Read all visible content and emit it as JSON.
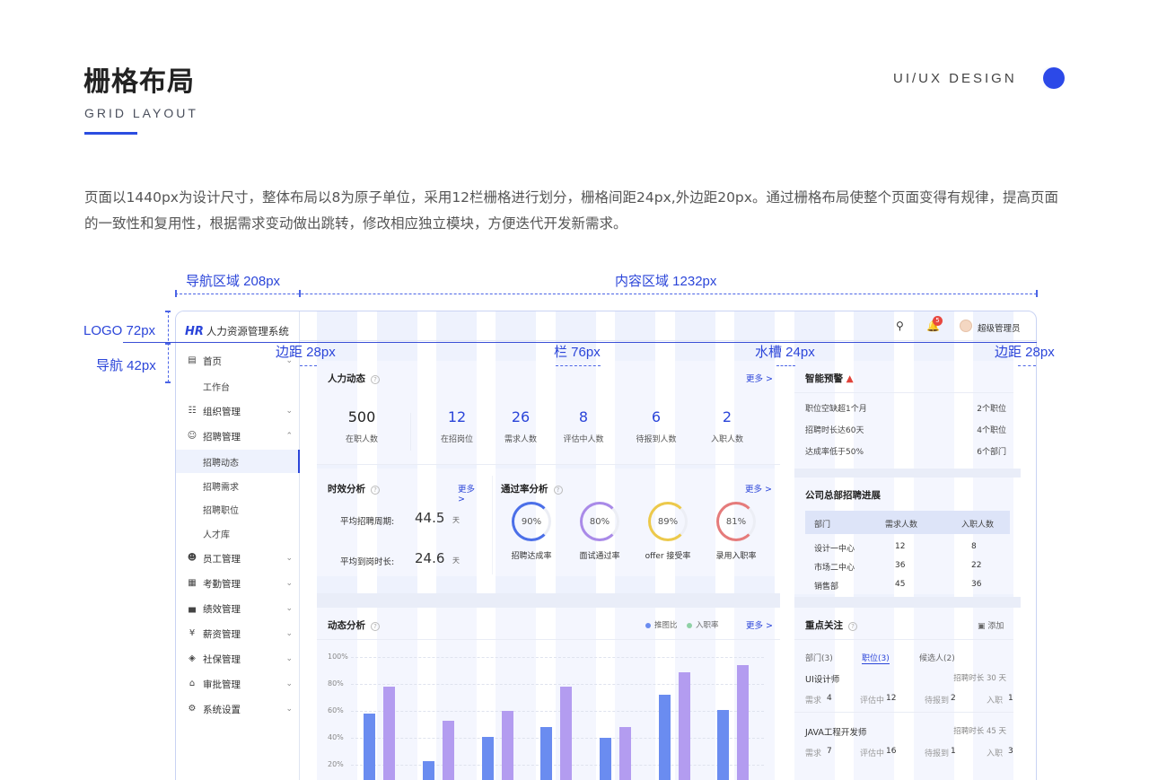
{
  "header": {
    "title": "栅格布局",
    "subtitle": "GRID LAYOUT",
    "brand_tag": "UI/UX DESIGN"
  },
  "description": "页面以1440px为设计尺寸，整体布局以8为原子单位，采用12栏栅格进行划分，栅格间距24px,外边距20px。通过栅格布局使整个页面变得有规律，提高页面的一致性和复用性，根据需求变动做出跳转，修改相应独立模块，方便迭代开发新需求。",
  "annotations": {
    "nav_area": "导航区域 208px",
    "content_area": "内容区域 1232px",
    "logo": "LOGO 72px",
    "nav": "导航 42px",
    "margin_left": "边距 28px",
    "column": "栏 76px",
    "gutter": "水槽 24px",
    "margin_right": "边距 28px"
  },
  "app": {
    "brand_mark": "HR",
    "brand_name": "人力资源管理系统",
    "notification_count": "5",
    "user_name": "超级管理员",
    "nav": [
      {
        "label": "首页",
        "icon": "dashboard-icon",
        "expandable": true
      },
      {
        "label": "工作台",
        "sub": true
      },
      {
        "label": "组织管理",
        "icon": "org-icon",
        "expandable": true
      },
      {
        "label": "招聘管理",
        "icon": "user-icon",
        "expandable": true,
        "open": true
      },
      {
        "label": "招聘动态",
        "sub": true,
        "active": true
      },
      {
        "label": "招聘需求",
        "sub": true
      },
      {
        "label": "招聘职位",
        "sub": true
      },
      {
        "label": "人才库",
        "sub": true
      },
      {
        "label": "员工管理",
        "icon": "staff-icon",
        "expandable": true
      },
      {
        "label": "考勤管理",
        "icon": "calendar-icon",
        "expandable": true
      },
      {
        "label": "绩效管理",
        "icon": "chart-icon",
        "expandable": true
      },
      {
        "label": "薪资管理",
        "icon": "money-icon",
        "expandable": true
      },
      {
        "label": "社保管理",
        "icon": "shield-icon",
        "expandable": true
      },
      {
        "label": "审批管理",
        "icon": "stamp-icon",
        "expandable": true
      },
      {
        "label": "系统设置",
        "icon": "gear-icon",
        "expandable": true
      }
    ],
    "hr_dynamics": {
      "title": "人力动态",
      "more": "更多 >",
      "stats": [
        {
          "value": "500",
          "label": "在职人数"
        },
        {
          "value": "12",
          "label": "在招岗位"
        },
        {
          "value": "26",
          "label": "需求人数"
        },
        {
          "value": "8",
          "label": "评估中人数"
        },
        {
          "value": "6",
          "label": "待报到人数"
        },
        {
          "value": "2",
          "label": "入职人数"
        }
      ]
    },
    "efficiency": {
      "title": "时效分析",
      "more": "更多 >",
      "rows": [
        {
          "label": "平均招聘周期:",
          "value": "44.5",
          "unit": "天"
        },
        {
          "label": "平均到岗时长:",
          "value": "24.6",
          "unit": "天"
        }
      ]
    },
    "pass_rate": {
      "title": "通过率分析",
      "more": "更多 >",
      "items": [
        {
          "value": "90%",
          "label": "招聘达成率",
          "color": "#4b6fe8"
        },
        {
          "value": "80%",
          "label": "面试通过率",
          "color": "#a98ae8"
        },
        {
          "value": "89%",
          "label": "offer 接受率",
          "color": "#ecc94b"
        },
        {
          "value": "81%",
          "label": "录用入职率",
          "color": "#e57b7b"
        }
      ]
    },
    "trend": {
      "title": "动态分析",
      "more": "更多 >",
      "legend": [
        {
          "name": "推图比",
          "color": "#6a8cf0"
        },
        {
          "name": "入职率",
          "color": "#8fd1a6"
        }
      ]
    },
    "warning": {
      "title": "智能预警",
      "rows": [
        {
          "label": "职位空缺超1个月",
          "value": "2个职位"
        },
        {
          "label": "招聘时长达60天",
          "value": "4个职位"
        },
        {
          "label": "达成率低于50%",
          "value": "6个部门"
        }
      ]
    },
    "progress": {
      "title": "公司总部招聘进展",
      "columns": [
        "部门",
        "需求人数",
        "入职人数"
      ],
      "rows": [
        [
          "设计一中心",
          "12",
          "8"
        ],
        [
          "市场二中心",
          "36",
          "22"
        ],
        [
          "销售部",
          "45",
          "36"
        ]
      ]
    },
    "focus": {
      "title": "重点关注",
      "add": "添加",
      "tabs": [
        "部门(3)",
        "职位(3)",
        "候选人(2)"
      ],
      "items": [
        {
          "name": "UI设计师",
          "duration": "招聘时长 30 天",
          "need": "需求",
          "need_v": "4",
          "eval": "评估中",
          "eval_v": "12",
          "wait": "待报到",
          "wait_v": "2",
          "join": "入职",
          "join_v": "1"
        },
        {
          "name": "JAVA工程开发师",
          "duration": "招聘时长 45 天",
          "need": "需求",
          "need_v": "7",
          "eval": "评估中",
          "eval_v": "16",
          "wait": "待报到",
          "wait_v": "1",
          "join": "入职",
          "join_v": "3"
        }
      ]
    }
  },
  "chart_data": {
    "type": "bar",
    "title": "动态分析",
    "ylim": [
      0,
      100
    ],
    "yticks": [
      "100%",
      "80%",
      "60%",
      "40%",
      "20%"
    ],
    "series": [
      {
        "name": "推图比",
        "color": "#6a8cf0",
        "values": [
          58,
          23,
          41,
          48,
          40,
          72,
          61
        ]
      },
      {
        "name": "入职率",
        "color": "#b39cf0",
        "values": [
          78,
          53,
          60,
          78,
          48,
          89,
          94
        ]
      }
    ]
  }
}
